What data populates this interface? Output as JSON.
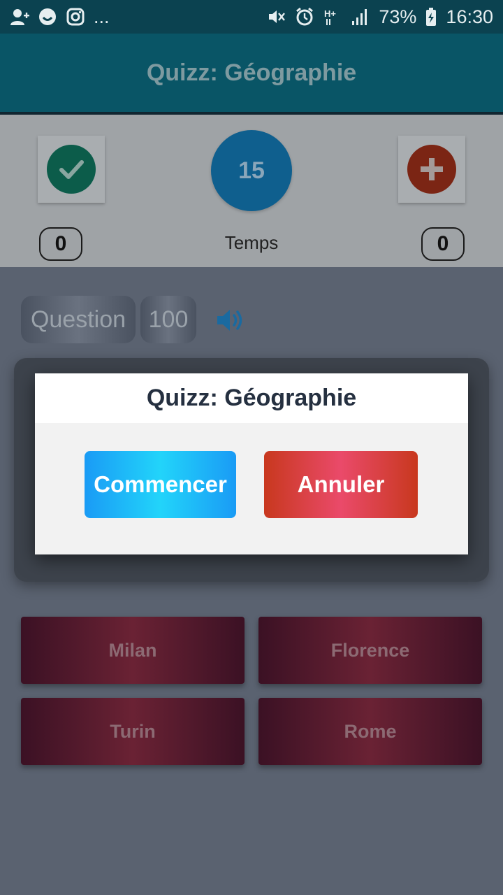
{
  "status_bar": {
    "dots": "...",
    "battery": "73%",
    "time": "16:30",
    "icons": [
      "add-contact-icon",
      "smiley-icon",
      "instagram-icon",
      "mute-icon",
      "alarm-icon",
      "hplus-icon",
      "signal-icon",
      "battery-charging-icon"
    ]
  },
  "app_bar": {
    "title": "Quizz: Géographie"
  },
  "score": {
    "correct_count": "0",
    "wrong_count": "0",
    "timer_value": "15",
    "timer_label": "Temps",
    "correct_color": "#0c5c4a",
    "wrong_color": "#7b2514",
    "timer_color": "#0f5f8e"
  },
  "question": {
    "label": "Question",
    "number": "100"
  },
  "answers": [
    "Milan",
    "Florence",
    "Turin",
    "Rome"
  ],
  "dialog": {
    "title": "Quizz: Géographie",
    "start_label": "Commencer",
    "cancel_label": "Annuler"
  }
}
